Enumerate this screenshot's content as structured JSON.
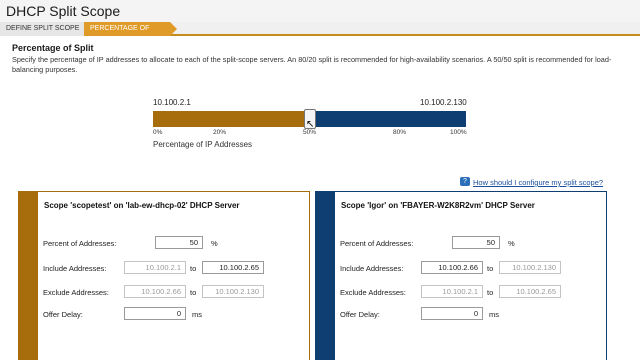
{
  "page": {
    "title": "DHCP Split Scope"
  },
  "wizard": {
    "steps": [
      {
        "label": "DEFINE SPLIT SCOPE"
      },
      {
        "label": "PERCENTAGE OF SPLIT"
      }
    ]
  },
  "section": {
    "title": "Percentage of Split",
    "description": "Specify the percentage of IP addresses to allocate to each of the split-scope servers. An 80/20 split is recommended for high-availability scenarios. A 50/50 split is recommended for load-balancing purposes."
  },
  "slider": {
    "left_ip": "10.100.2.1",
    "right_ip": "10.100.2.130",
    "split_percent": 50,
    "left_color": "#a76d0c",
    "right_color": "#0f3e73",
    "ticks": [
      "0%",
      "20%",
      "50%",
      "80%",
      "100%"
    ],
    "caption": "Percentage of IP Addresses"
  },
  "help": {
    "label": "How should I configure my split scope?",
    "icon": "help-icon"
  },
  "scope_left": {
    "title": "Scope 'scopetest' on 'lab-ew-dhcp-02' DHCP Server",
    "percent_label": "Percent of Addresses:",
    "percent_value": "50",
    "percent_unit": "%",
    "include_label": "Include Addresses:",
    "include_from": "10.100.2.1",
    "include_to": "10.100.2.65",
    "exclude_label": "Exclude Addresses:",
    "exclude_from": "10.100.2.66",
    "exclude_to": "10.100.2.130",
    "to_label": "to",
    "delay_label": "Offer Delay:",
    "delay_value": "0",
    "delay_unit": "ms"
  },
  "scope_right": {
    "title": "Scope 'Igor' on 'FBAYER-W2K8R2vm' DHCP Server",
    "percent_label": "Percent of Addresses:",
    "percent_value": "50",
    "percent_unit": "%",
    "include_label": "Include Addresses:",
    "include_from": "10.100.2.66",
    "include_to": "10.100.2.130",
    "exclude_label": "Exclude Addresses:",
    "exclude_from": "10.100.2.1",
    "exclude_to": "10.100.2.65",
    "to_label": "to",
    "delay_label": "Offer Delay:",
    "delay_value": "0",
    "delay_unit": "ms"
  }
}
